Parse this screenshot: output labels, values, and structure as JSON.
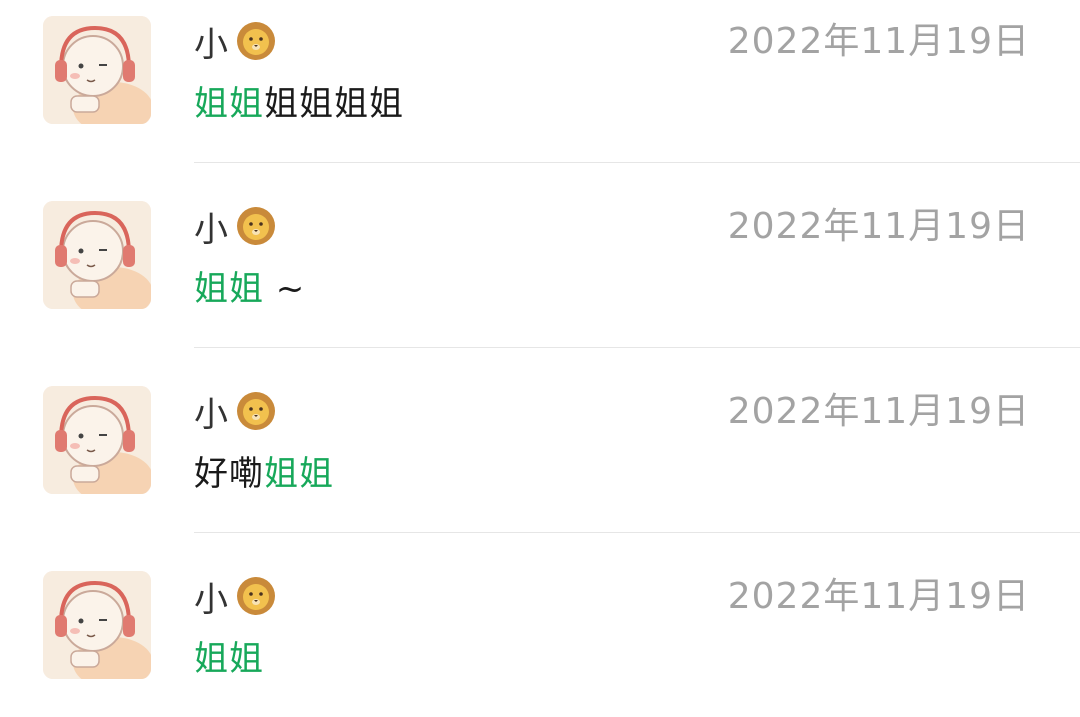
{
  "comments": [
    {
      "name": "小",
      "name_emoji_icon": "lion-face-icon",
      "date": "2022年11月19日",
      "message": {
        "highlight": "姐姐",
        "plain": "姐姐姐姐"
      }
    },
    {
      "name": "小",
      "name_emoji_icon": "lion-face-icon",
      "date": "2022年11月19日",
      "message": {
        "highlight": "姐姐",
        "plain": " ~"
      }
    },
    {
      "name": "小",
      "name_emoji_icon": "lion-face-icon",
      "date": "2022年11月19日",
      "message": {
        "plain_before": "好嘞",
        "highlight": "姐姐"
      }
    },
    {
      "name": "小",
      "name_emoji_icon": "lion-face-icon",
      "date": "2022年11月19日",
      "message": {
        "highlight": "姐姐"
      }
    }
  ],
  "colors": {
    "highlight": "#17a85a",
    "text": "#1a1a1a",
    "date": "#a3a3a3",
    "divider": "#e6e6e6",
    "avatar_bg": "#f6ebe1"
  }
}
